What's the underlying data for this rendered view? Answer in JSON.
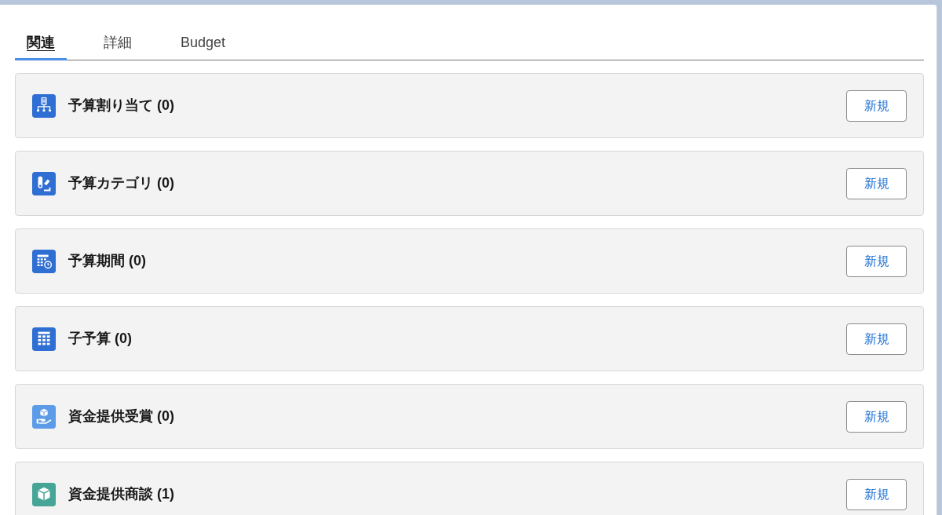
{
  "tabs": [
    {
      "label": "関連",
      "selected": true
    },
    {
      "label": "詳細",
      "selected": false
    },
    {
      "label": "Budget",
      "selected": false
    }
  ],
  "sections": [
    {
      "kind": "hierarchy",
      "color": "#2f6ed3",
      "title": "予算割り当て (0)",
      "button": "新規"
    },
    {
      "kind": "category",
      "color": "#2f6ed3",
      "title": "予算カテゴリ (0)",
      "button": "新規"
    },
    {
      "kind": "period",
      "color": "#2f6ed3",
      "title": "予算期間 (0)",
      "button": "新規"
    },
    {
      "kind": "table",
      "color": "#2f6ed3",
      "title": "子予算 (0)",
      "button": "新規"
    },
    {
      "kind": "award",
      "color": "#5b9be8",
      "title": "資金提供受賞 (0)",
      "button": "新規"
    },
    {
      "kind": "opportunity",
      "color": "#46a596",
      "title": "資金提供商談 (1)",
      "button": "新規"
    }
  ]
}
